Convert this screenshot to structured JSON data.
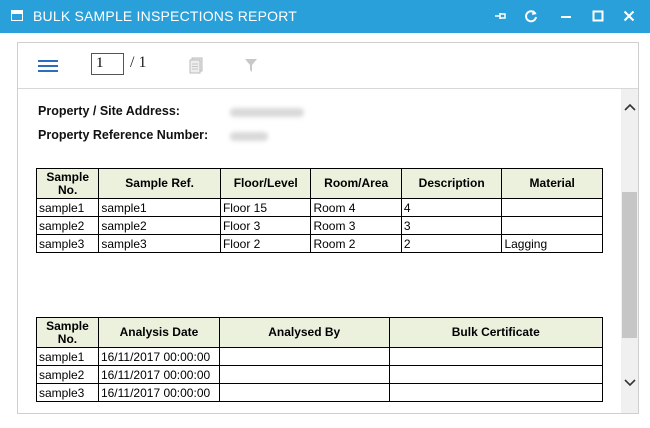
{
  "window": {
    "title": "BULK SAMPLE INSPECTIONS REPORT"
  },
  "toolbar": {
    "page_current": "1",
    "page_total": "/ 1"
  },
  "report": {
    "address_label": "Property / Site Address:",
    "reference_label": "Property Reference Number:",
    "table1": {
      "headers": [
        "Sample No.",
        "Sample Ref.",
        "Floor/Level",
        "Room/Area",
        "Description",
        "Material"
      ],
      "rows": [
        [
          "sample1",
          "sample1",
          "Floor 15",
          "Room 4",
          "4",
          ""
        ],
        [
          "sample2",
          "sample2",
          "Floor 3",
          "Room 3",
          "3",
          ""
        ],
        [
          "sample3",
          "sample3",
          "Floor 2",
          "Room 2",
          "2",
          "Lagging"
        ]
      ]
    },
    "table2": {
      "headers": [
        "Sample No.",
        "Analysis Date",
        "Analysed By",
        "Bulk Certificate"
      ],
      "rows": [
        [
          "sample1",
          "16/11/2017 00:00:00",
          "",
          ""
        ],
        [
          "sample2",
          "16/11/2017 00:00:00",
          "",
          ""
        ],
        [
          "sample3",
          "16/11/2017 00:00:00",
          "",
          ""
        ]
      ]
    }
  },
  "icons": {
    "app": "window-icon",
    "pin": "pin-icon",
    "refresh": "refresh-icon",
    "minimize": "minimize-icon",
    "maximize": "maximize-icon",
    "close": "close-icon",
    "menu": "hamburger-icon",
    "document": "document-icon",
    "filter": "filter-icon",
    "scroll_up": "chevron-up-icon",
    "scroll_down": "chevron-down-icon"
  },
  "colors": {
    "titlebar": "#2aa0da",
    "header_fill": "#ebf1dd",
    "accent": "#2a6fb7"
  }
}
